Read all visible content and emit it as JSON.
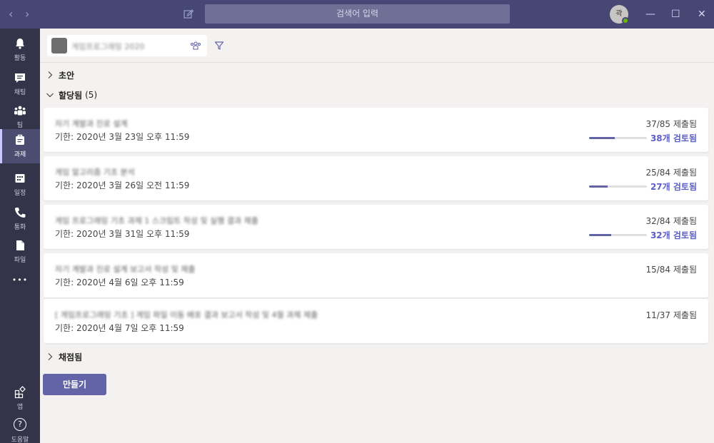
{
  "titlebar": {
    "search_placeholder": "검색어 입력",
    "avatar_initials": "곽",
    "back_glyph": "‹",
    "forward_glyph": "›",
    "minimize_glyph": "—",
    "maximize_glyph": "☐",
    "close_glyph": "✕"
  },
  "appbar": {
    "items": [
      {
        "label": "활동",
        "icon": "bell-icon"
      },
      {
        "label": "채팅",
        "icon": "chat-icon"
      },
      {
        "label": "팀",
        "icon": "teams-icon"
      },
      {
        "label": "과제",
        "icon": "assignments-icon",
        "active": true
      },
      {
        "label": "일정",
        "icon": "calendar-icon"
      },
      {
        "label": "통화",
        "icon": "phone-icon"
      },
      {
        "label": "파일",
        "icon": "file-icon"
      },
      {
        "label": "",
        "icon": "more-icon"
      }
    ],
    "bottom": [
      {
        "label": "앱",
        "icon": "apps-icon"
      },
      {
        "label": "도움말",
        "icon": "help-icon"
      }
    ],
    "more_glyph": "•••",
    "help_glyph": "?"
  },
  "toolbar": {
    "class_name": "게임프로그래밍 2020"
  },
  "sections": {
    "draft": {
      "title": "초안"
    },
    "assigned": {
      "title": "할당됨",
      "count": "(5)"
    },
    "graded": {
      "title": "채점됨"
    }
  },
  "assignments": [
    {
      "title": "자기 계발과 진로 설계",
      "due": "기한: 2020년 3월 23일 오후 11:59",
      "submitted": "37/85 제출됨",
      "reviewed": "38개 검토됨",
      "progress": 0.45
    },
    {
      "title": "게임 알고리즘 기초 분석",
      "due": "기한: 2020년 3월 26일 오전 11:59",
      "submitted": "25/84 제출됨",
      "reviewed": "27개 검토됨",
      "progress": 0.32
    },
    {
      "title": "게임 프로그래밍 기초 과제 1 스크립트 작성 및 실행 결과 제출",
      "due": "기한: 2020년 3월 31일 오후 11:59",
      "submitted": "32/84 제출됨",
      "reviewed": "32개 검토됨",
      "progress": 0.38
    },
    {
      "title": "자기 계발과 진로 설계 보고서 작성 및 제출",
      "due": "기한: 2020년 4월 6일 오후 11:59",
      "submitted": "15/84 제출됨",
      "reviewed": "",
      "progress": null
    },
    {
      "title": "[ 게임프로그래밍 기초 ] 게임 파일 이동 배포 결과 보고서 작성 및 4월 과제 제출",
      "due": "기한: 2020년 4월 7일 오후 11:59",
      "submitted": "11/37 제출됨",
      "reviewed": "",
      "progress": null
    }
  ],
  "actions": {
    "create_label": "만들기"
  },
  "colors": {
    "titlebar": "#464775",
    "appbar": "#33344a",
    "accent": "#6264a7",
    "review_text": "#5b5fc7"
  }
}
